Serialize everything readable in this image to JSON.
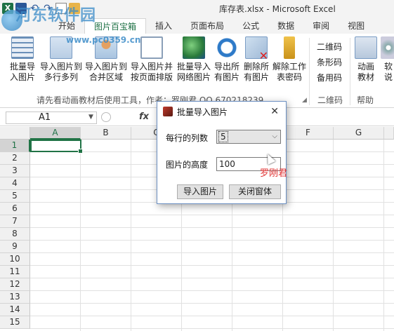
{
  "window": {
    "title": "库存表.xlsx  -  Microsoft Excel"
  },
  "watermark": {
    "brand": "河东软件园",
    "url": "www.pc0359.cn"
  },
  "tabs": [
    "开始",
    "图片百宝箱",
    "插入",
    "页面布局",
    "公式",
    "数据",
    "审阅",
    "视图"
  ],
  "ribbon": {
    "buttons": [
      {
        "line1": "批量导",
        "line2": "入图片",
        "icon": "grid-import-icon"
      },
      {
        "line1": "导入图片到",
        "line2": "多行多列",
        "icon": "table-icon"
      },
      {
        "line1": "导入图片到",
        "line2": "合并区域",
        "icon": "person-card-icon"
      },
      {
        "line1": "导入图片并",
        "line2": "按页面排版",
        "icon": "frame-icon"
      },
      {
        "line1": "批量导入",
        "line2": "网络图片",
        "icon": "globe-person-icon"
      },
      {
        "line1": "导出所",
        "line2": "有图片",
        "icon": "export-arrow-icon"
      },
      {
        "line1": "删除所",
        "line2": "有图片",
        "icon": "delete-image-icon"
      },
      {
        "line1": "解除工作",
        "line2": "表密码",
        "icon": "key-icon"
      }
    ],
    "small_items": [
      "二维码",
      "条形码",
      "备用码"
    ],
    "help_buttons": [
      {
        "line1": "动画",
        "line2": "教材",
        "icon": "video-icon"
      },
      {
        "line1": "软",
        "line2": "说",
        "icon": "disc-icon"
      }
    ],
    "group_note": "请先看动画教材后使用工具，作者：罗刚君 QQ 670218239",
    "group_qr": "二维码",
    "group_help": "帮助"
  },
  "formula_bar": {
    "name_box": "A1",
    "fx": "fx"
  },
  "grid": {
    "columns": [
      "A",
      "B",
      "C",
      "D",
      "E",
      "F",
      "G"
    ],
    "rows": [
      "1",
      "2",
      "3",
      "4",
      "5",
      "6",
      "7",
      "8",
      "9",
      "10",
      "11",
      "12",
      "13",
      "14",
      "15"
    ],
    "selected_cell": "A1"
  },
  "dialog": {
    "title": "批量导入图片",
    "columns_label": "每行的列数",
    "columns_value": "5",
    "height_label": "图片的高度",
    "height_value": "100",
    "import_button": "导入图片",
    "close_button": "关闭窗体",
    "signature": "罗刚君"
  }
}
